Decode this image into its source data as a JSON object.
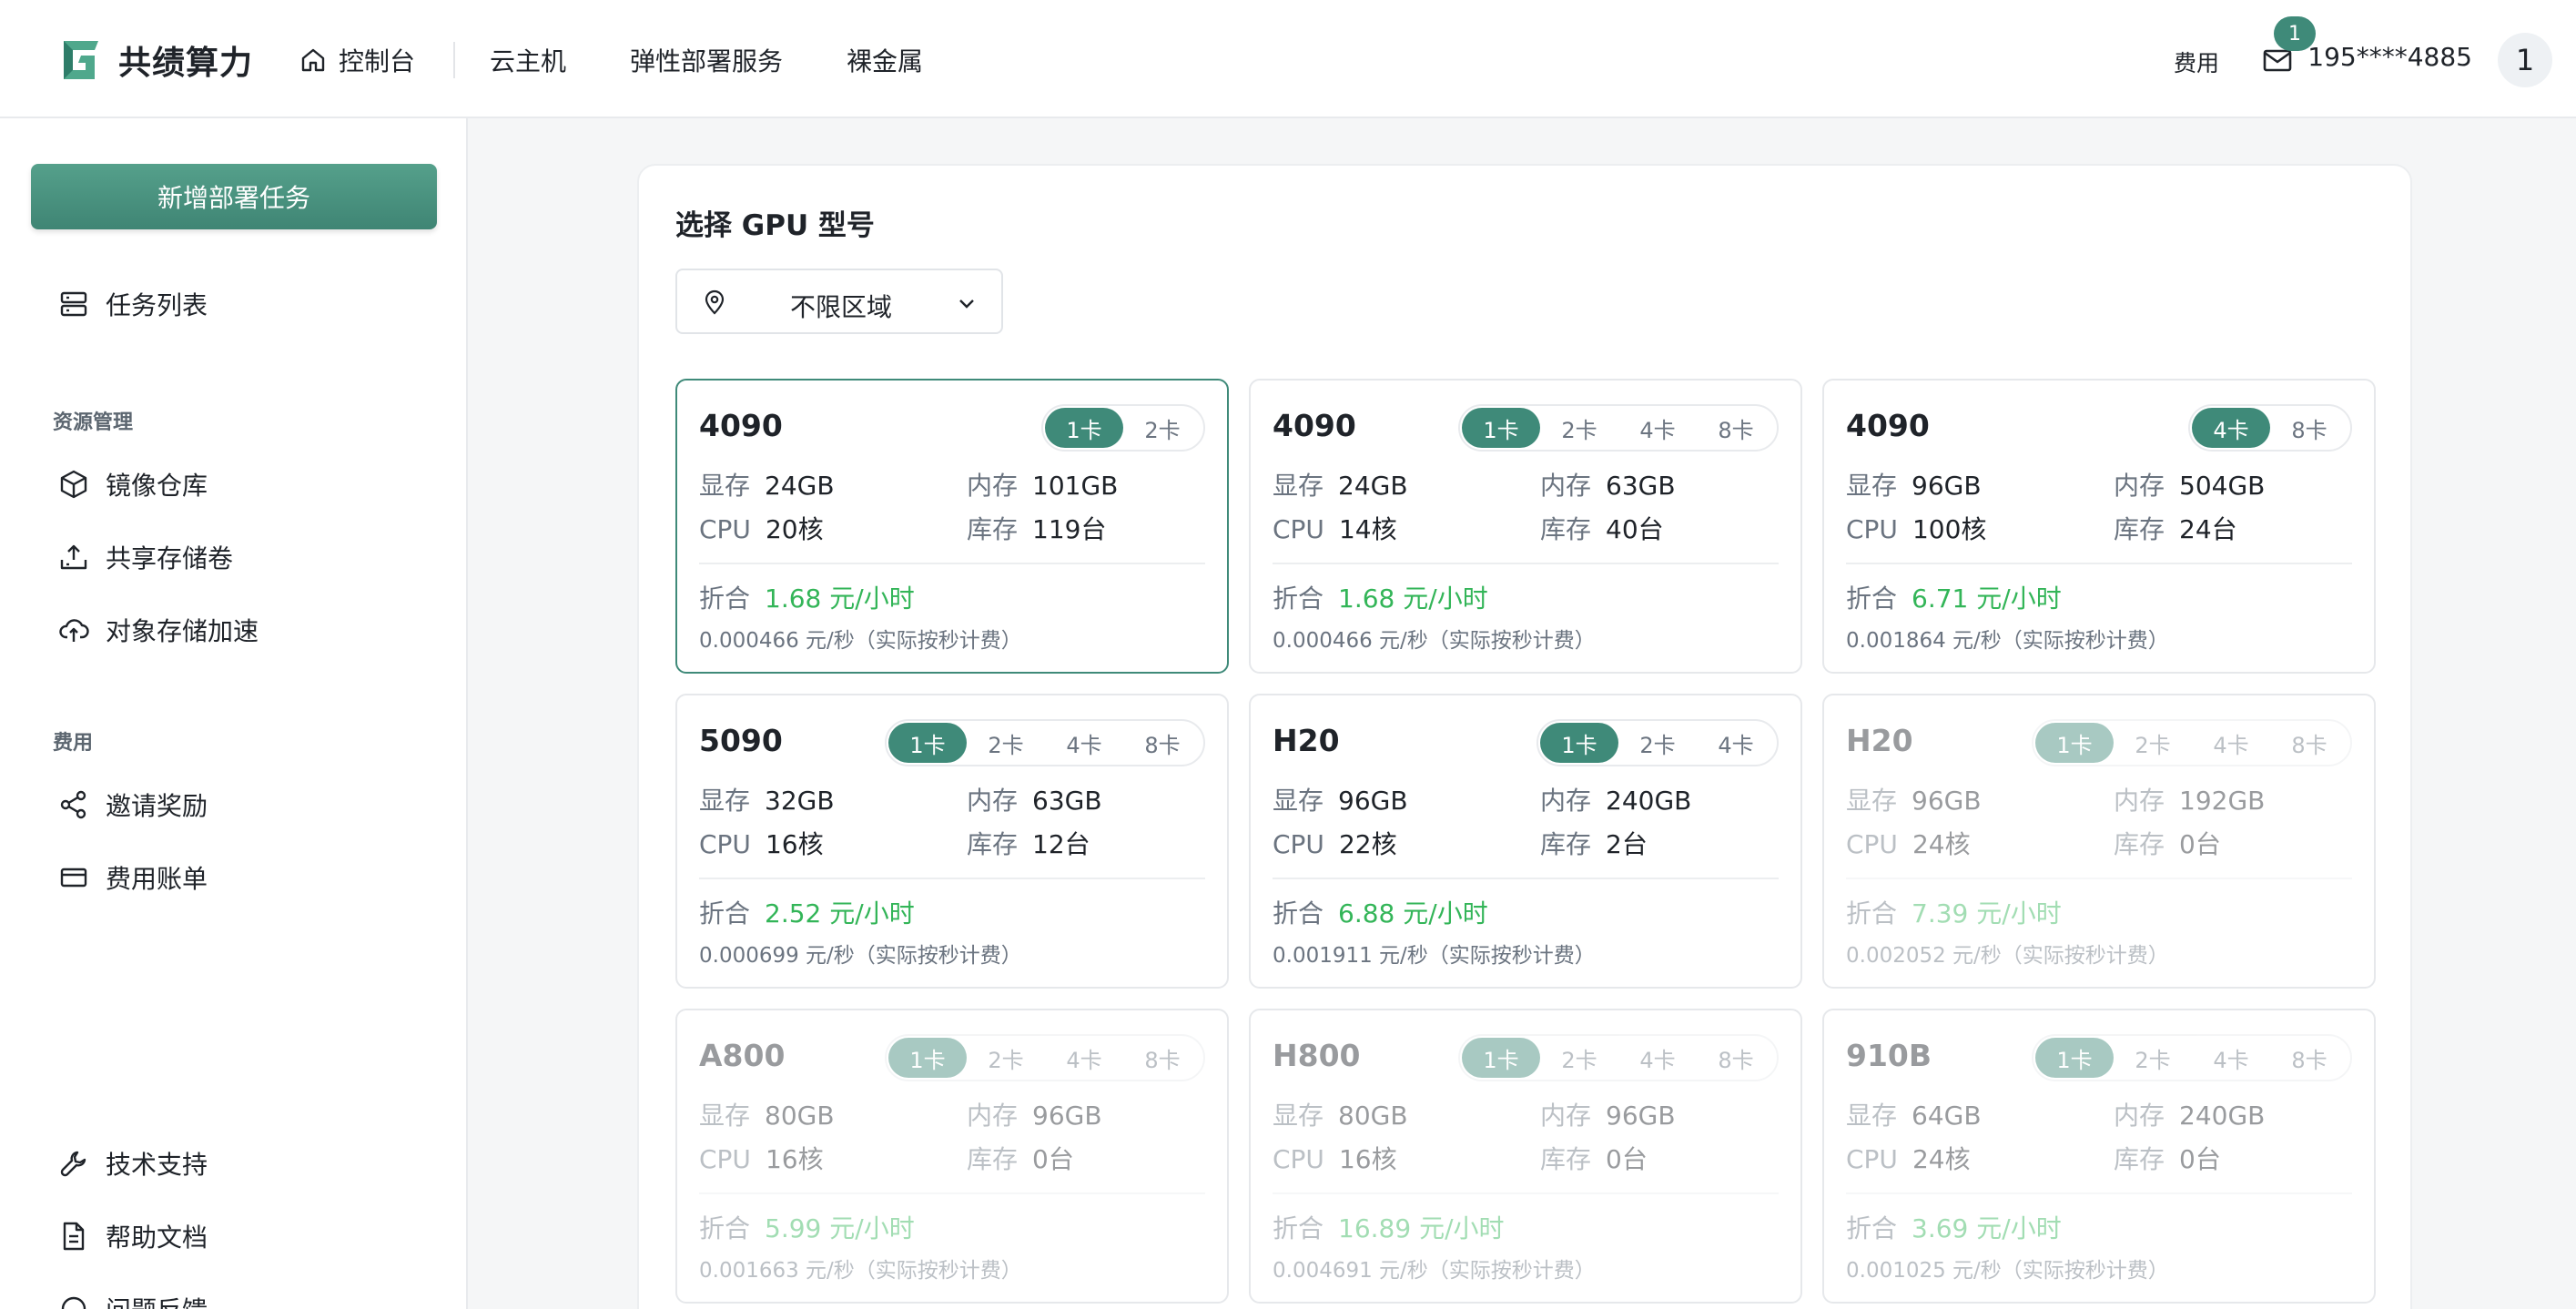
{
  "header": {
    "logo_text": "共绩算力",
    "nav": [
      {
        "label": "控制台",
        "icon": "home-icon"
      },
      {
        "label": "云主机"
      },
      {
        "label": "弹性部署服务"
      },
      {
        "label": "裸金属"
      }
    ],
    "fee_label": "费用",
    "message_count": "1",
    "phone": "195****4885",
    "avatar_label": "1"
  },
  "sidebar": {
    "new_task_label": "新增部署任务",
    "task_list_label": "任务列表",
    "group_resources": "资源管理",
    "image_repo_label": "镜像仓库",
    "shared_volume_label": "共享存储卷",
    "object_storage_label": "对象存储加速",
    "group_fee": "费用",
    "invite_label": "邀请奖励",
    "bill_label": "费用账单",
    "support_label": "技术支持",
    "docs_label": "帮助文档",
    "feedback_label": "问题反馈"
  },
  "main": {
    "title": "选择 GPU 型号",
    "region_value": "不限区域",
    "spec_labels": {
      "vram": "显存",
      "mem": "内存",
      "cpu": "CPU",
      "stock": "库存",
      "price": "折合"
    },
    "cards": [
      {
        "name": "4090",
        "options": [
          "1卡",
          "2卡"
        ],
        "active": 0,
        "vram": "24GB",
        "mem": "101GB",
        "cpu": "20核",
        "stock": "119台",
        "price": "1.68 元/小时",
        "per_sec": "0.000466 元/秒（实际按秒计费）",
        "state": "selected"
      },
      {
        "name": "4090",
        "options": [
          "1卡",
          "2卡",
          "4卡",
          "8卡"
        ],
        "active": 0,
        "vram": "24GB",
        "mem": "63GB",
        "cpu": "14核",
        "stock": "40台",
        "price": "1.68 元/小时",
        "per_sec": "0.000466 元/秒（实际按秒计费）",
        "state": "normal"
      },
      {
        "name": "4090",
        "options": [
          "4卡",
          "8卡"
        ],
        "active": 0,
        "vram": "96GB",
        "mem": "504GB",
        "cpu": "100核",
        "stock": "24台",
        "price": "6.71 元/小时",
        "per_sec": "0.001864 元/秒（实际按秒计费）",
        "state": "normal"
      },
      {
        "name": "5090",
        "options": [
          "1卡",
          "2卡",
          "4卡",
          "8卡"
        ],
        "active": 0,
        "vram": "32GB",
        "mem": "63GB",
        "cpu": "16核",
        "stock": "12台",
        "price": "2.52 元/小时",
        "per_sec": "0.000699 元/秒（实际按秒计费）",
        "state": "normal"
      },
      {
        "name": "H20",
        "options": [
          "1卡",
          "2卡",
          "4卡"
        ],
        "active": 0,
        "vram": "96GB",
        "mem": "240GB",
        "cpu": "22核",
        "stock": "2台",
        "price": "6.88 元/小时",
        "per_sec": "0.001911 元/秒（实际按秒计费）",
        "state": "normal"
      },
      {
        "name": "H20",
        "options": [
          "1卡",
          "2卡",
          "4卡",
          "8卡"
        ],
        "active": 0,
        "vram": "96GB",
        "mem": "192GB",
        "cpu": "24核",
        "stock": "0台",
        "price": "7.39 元/小时",
        "per_sec": "0.002052 元/秒（实际按秒计费）",
        "state": "disabled"
      },
      {
        "name": "A800",
        "options": [
          "1卡",
          "2卡",
          "4卡",
          "8卡"
        ],
        "active": 0,
        "vram": "80GB",
        "mem": "96GB",
        "cpu": "16核",
        "stock": "0台",
        "price": "5.99 元/小时",
        "per_sec": "0.001663 元/秒（实际按秒计费）",
        "state": "disabled"
      },
      {
        "name": "H800",
        "options": [
          "1卡",
          "2卡",
          "4卡",
          "8卡"
        ],
        "active": 0,
        "vram": "80GB",
        "mem": "96GB",
        "cpu": "16核",
        "stock": "0台",
        "price": "16.89 元/小时",
        "per_sec": "0.004691 元/秒（实际按秒计费）",
        "state": "disabled"
      },
      {
        "name": "910B",
        "options": [
          "1卡",
          "2卡",
          "4卡",
          "8卡"
        ],
        "active": 0,
        "vram": "64GB",
        "mem": "240GB",
        "cpu": "24核",
        "stock": "0台",
        "price": "3.69 元/小时",
        "per_sec": "0.001025 元/秒（实际按秒计费）",
        "state": "disabled"
      }
    ]
  },
  "colors": {
    "accent": "#3f8a79",
    "price_green": "#33b558"
  }
}
